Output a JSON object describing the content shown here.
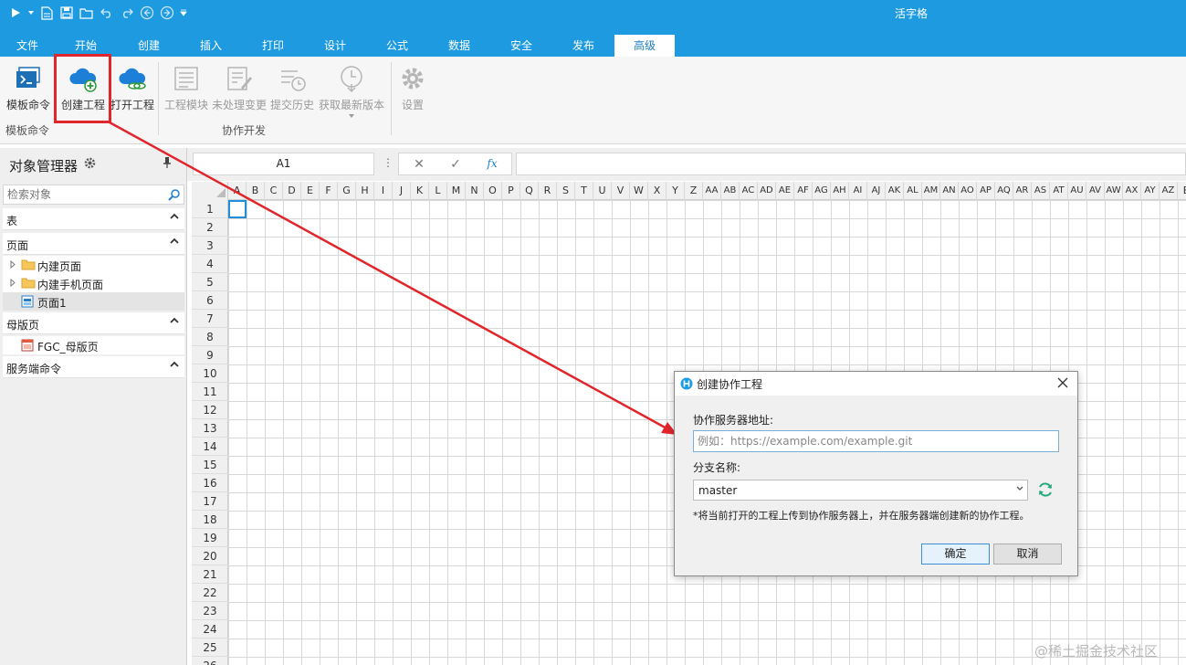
{
  "app": {
    "title": "活字格"
  },
  "qat": {
    "icons": [
      "run-icon",
      "new-file-icon",
      "save-icon",
      "open-folder-icon",
      "undo-icon",
      "redo-icon",
      "back-icon",
      "forward-icon",
      "customize-icon"
    ]
  },
  "tabs": [
    {
      "label": "文件"
    },
    {
      "label": "开始"
    },
    {
      "label": "创建"
    },
    {
      "label": "插入"
    },
    {
      "label": "打印"
    },
    {
      "label": "设计"
    },
    {
      "label": "公式"
    },
    {
      "label": "数据"
    },
    {
      "label": "安全"
    },
    {
      "label": "发布"
    },
    {
      "label": "高级",
      "active": true
    }
  ],
  "ribbon": {
    "template_cmd": "模板命令",
    "create_project": "创建工程",
    "open_project": "打开工程",
    "project_module": "工程模块",
    "uncommitted": "未处理变更",
    "commit_history": "提交历史",
    "get_latest": "获取最新版本",
    "settings": "设置",
    "group_template": "模板命令",
    "group_collab": "协作开发"
  },
  "left_panel": {
    "title": "对象管理器",
    "search_placeholder": "检索对象",
    "sections": {
      "table": "表",
      "page": "页面",
      "master": "母版页",
      "server": "服务端命令"
    },
    "page_items": [
      "内建页面",
      "内建手机页面",
      "页面1"
    ],
    "master_items": [
      "FGC_母版页"
    ]
  },
  "formula_bar": {
    "name_box": "A1",
    "fx": "fx"
  },
  "grid": {
    "columns": [
      "A",
      "B",
      "C",
      "D",
      "E",
      "F",
      "G",
      "H",
      "I",
      "J",
      "K",
      "L",
      "M",
      "N",
      "O",
      "P",
      "Q",
      "R",
      "S",
      "T",
      "U",
      "V",
      "W",
      "X",
      "Y",
      "Z",
      "AA",
      "AB",
      "AC",
      "AD",
      "AE",
      "AF",
      "AG",
      "AH",
      "AI",
      "AJ",
      "AK",
      "AL",
      "AM",
      "AN",
      "AO",
      "AP",
      "AQ",
      "AR",
      "AS",
      "AT",
      "AU",
      "AV",
      "AW",
      "AX",
      "AY",
      "AZ",
      "B"
    ],
    "rows": [
      "1",
      "2",
      "3",
      "4",
      "5",
      "6",
      "7",
      "8",
      "9",
      "10",
      "11",
      "12",
      "13",
      "14",
      "15",
      "16",
      "17",
      "18",
      "19",
      "20",
      "21",
      "22",
      "23",
      "24",
      "25",
      "26"
    ]
  },
  "dialog": {
    "title": "创建协作工程",
    "server_label": "协作服务器地址:",
    "server_placeholder": "例如：https://example.com/example.git",
    "branch_label": "分支名称:",
    "branch_value": "master",
    "note": "*将当前打开的工程上传到协作服务器上，并在服务器端创建新的协作工程。",
    "ok": "确定",
    "cancel": "取消"
  },
  "watermark": "@稀土掘金技术社区",
  "colors": {
    "accent": "#1e9be0",
    "highlight": "#e0262b",
    "active_cell": "#1e8fd8"
  }
}
